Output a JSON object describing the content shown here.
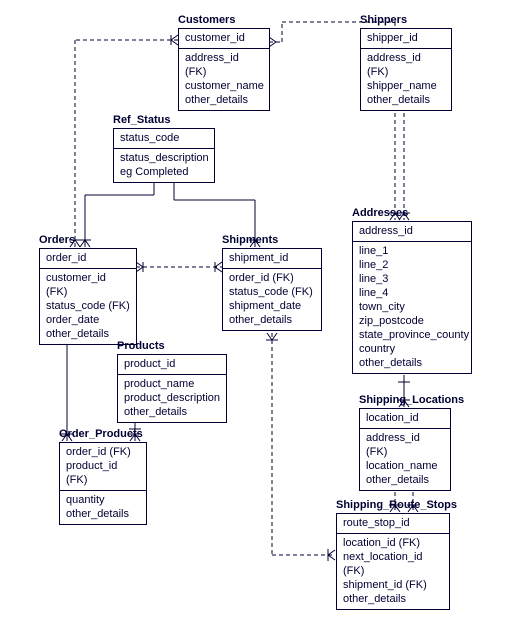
{
  "entities": {
    "customers": {
      "name": "Customers",
      "pk": [
        "customer_id"
      ],
      "attrs": [
        "address_id (FK)",
        "customer_name",
        "other_details"
      ]
    },
    "shippers": {
      "name": "Shippers",
      "pk": [
        "shipper_id"
      ],
      "attrs": [
        "address_id (FK)",
        "shipper_name",
        "other_details"
      ]
    },
    "ref_status": {
      "name": "Ref_Status",
      "pk": [
        "status_code"
      ],
      "attrs": [
        "status_description",
        "eg Completed"
      ]
    },
    "addresses": {
      "name": "Addresses",
      "pk": [
        "address_id"
      ],
      "attrs": [
        "line_1",
        "line_2",
        "line_3",
        "line_4",
        "town_city",
        "zip_postcode",
        "state_province_county",
        "country",
        "other_details"
      ]
    },
    "orders": {
      "name": "Orders",
      "pk": [
        "order_id"
      ],
      "attrs": [
        "customer_id (FK)",
        "status_code (FK)",
        "order_date",
        "other_details"
      ]
    },
    "shipments": {
      "name": "Shipments",
      "pk": [
        "shipment_id"
      ],
      "attrs": [
        "order_id (FK)",
        "status_code (FK)",
        "shipment_date",
        "other_details"
      ]
    },
    "products": {
      "name": "Products",
      "pk": [
        "product_id"
      ],
      "attrs": [
        "product_name",
        "product_description",
        "other_details"
      ]
    },
    "order_products": {
      "name": "Order_Products",
      "pk": [
        "order_id (FK)",
        "product_id (FK)"
      ],
      "attrs": [
        "quantity",
        "other_details"
      ]
    },
    "shipping_locations": {
      "name": "Shipping_Locations",
      "pk": [
        "location_id"
      ],
      "attrs": [
        "address_id (FK)",
        "location_name",
        "other_details"
      ]
    },
    "shipping_route_stops": {
      "name": "Shipping_Route_Stops",
      "pk": [
        "route_stop_id"
      ],
      "attrs": [
        "location_id (FK)",
        "next_location_id (FK)",
        "shipment_id (FK)",
        "other_details"
      ]
    }
  }
}
